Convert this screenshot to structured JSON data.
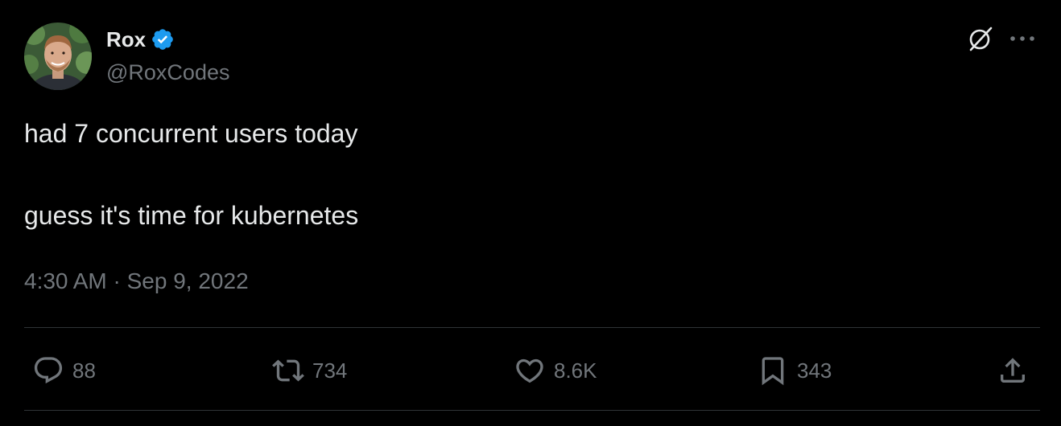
{
  "author": {
    "display_name": "Rox",
    "handle": "@RoxCodes",
    "verified": true,
    "verified_color": "#1d9bf0",
    "avatar_icon": "avatar"
  },
  "top_actions": {
    "grok_icon": "grok-icon",
    "more_icon": "more-icon"
  },
  "tweet": {
    "paragraphs": [
      "had 7 concurrent users today",
      "guess it's time for kubernetes"
    ],
    "time": "4:30 AM",
    "separator": " · ",
    "date": "Sep 9, 2022"
  },
  "engagement": {
    "replies": "88",
    "reposts": "734",
    "likes": "8.6K",
    "bookmarks": "343"
  },
  "colors": {
    "background": "#000000",
    "text_primary": "#e7e9ea",
    "text_secondary": "#71767b",
    "divider": "#2f3336"
  }
}
